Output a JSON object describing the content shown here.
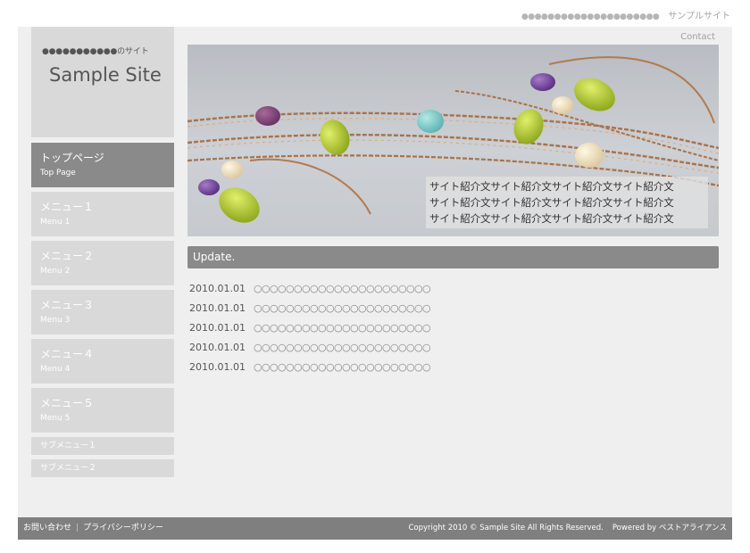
{
  "header": {
    "tag_dots": "●●●●●●●●●●●●●●●●●●●●●",
    "site_name": "サンプルサイト"
  },
  "logo": {
    "tagline": "●●●●●●●●●●●のサイト",
    "title": "Sample Site"
  },
  "contact_label": "Contact",
  "nav": {
    "items": [
      {
        "ja": "トップページ",
        "en": "Top Page"
      },
      {
        "ja": "メニュー１",
        "en": "Menu 1"
      },
      {
        "ja": "メニュー２",
        "en": "Menu 2"
      },
      {
        "ja": "メニュー３",
        "en": "Menu 3"
      },
      {
        "ja": "メニュー４",
        "en": "Menu 4"
      },
      {
        "ja": "メニュー５",
        "en": "Menu 5"
      }
    ],
    "sub_items": [
      "サブメニュー１",
      "サブメニュー２"
    ]
  },
  "hero": {
    "caption_lines": [
      "サイト紹介文サイト紹介文サイト紹介文サイト紹介文",
      "サイト紹介文サイト紹介文サイト紹介文サイト紹介文",
      "サイト紹介文サイト紹介文サイト紹介文サイト紹介文"
    ]
  },
  "update": {
    "title": "Update.",
    "items": [
      {
        "date": "2010.01.01",
        "text": "○○○○○○○○○○○○○○○○○○○○○○"
      },
      {
        "date": "2010.01.01",
        "text": "○○○○○○○○○○○○○○○○○○○○○○"
      },
      {
        "date": "2010.01.01",
        "text": "○○○○○○○○○○○○○○○○○○○○○○"
      },
      {
        "date": "2010.01.01",
        "text": "○○○○○○○○○○○○○○○○○○○○○○"
      },
      {
        "date": "2010.01.01",
        "text": "○○○○○○○○○○○○○○○○○○○○○○"
      }
    ]
  },
  "footer": {
    "contact": "お問い合わせ",
    "separator": "|",
    "privacy": "プライバシーポリシー",
    "copyright": "Copyright 2010 © Sample Site All Rights Reserved.",
    "powered": "Powered by ベストアライアンス"
  },
  "colors": {
    "nav_active": "#8a8a8a",
    "nav_inactive": "#d9d9d9",
    "frame_bg": "#efefef",
    "footer_bg": "#7f7f7f"
  }
}
